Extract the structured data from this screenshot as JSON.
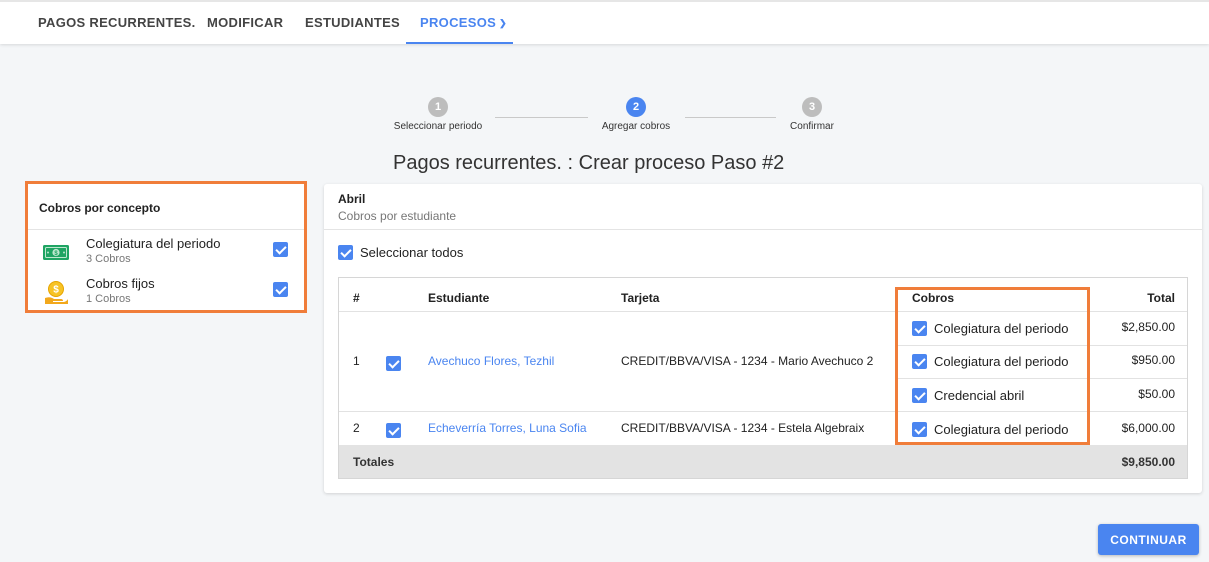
{
  "nav": {
    "tabs": [
      {
        "label": "PAGOS RECURRENTES."
      },
      {
        "label": "MODIFICAR"
      },
      {
        "label": "ESTUDIANTES"
      },
      {
        "label": "PROCESOS"
      }
    ]
  },
  "stepper": {
    "steps": [
      {
        "number": "1",
        "label": "Seleccionar periodo"
      },
      {
        "number": "2",
        "label": "Agregar cobros"
      },
      {
        "number": "3",
        "label": "Confirmar"
      }
    ],
    "active_step": 2
  },
  "page_title": "Pagos recurrentes. : Crear proceso Paso #2",
  "concepts": {
    "title": "Cobros por concepto",
    "items": [
      {
        "name": "Colegiatura del periodo",
        "count": "3 Cobros",
        "icon": "banknote-icon",
        "checked": true
      },
      {
        "name": "Cobros fijos",
        "count": "1 Cobros",
        "icon": "coin-hand-icon",
        "checked": true
      }
    ]
  },
  "panel": {
    "month": "Abril",
    "subtitle": "Cobros por estudiante",
    "select_all_label": "Seleccionar todos",
    "select_all_checked": true
  },
  "table": {
    "headers": {
      "num": "#",
      "student": "Estudiante",
      "card": "Tarjeta",
      "charges": "Cobros",
      "total": "Total"
    },
    "rows": [
      {
        "num": "1",
        "student": "Avechuco Flores, Tezhil",
        "card": "CREDIT/BBVA/VISA - 1234 - Mario Avechuco 2",
        "checked": true,
        "charges": [
          {
            "label": "Colegiatura del periodo",
            "amount": "$2,850.00",
            "checked": true
          },
          {
            "label": "Colegiatura del periodo",
            "amount": "$950.00",
            "checked": true
          },
          {
            "label": "Credencial abril",
            "amount": "$50.00",
            "checked": true
          }
        ]
      },
      {
        "num": "2",
        "student": "Echeverría Torres, Luna Sofia",
        "card": "CREDIT/BBVA/VISA - 1234 - Estela Algebraix",
        "checked": true,
        "charges": [
          {
            "label": "Colegiatura del periodo",
            "amount": "$6,000.00",
            "checked": true
          }
        ]
      }
    ],
    "totals_label": "Totales",
    "totals_value": "$9,850.00"
  },
  "continue_label": "CONTINUAR",
  "colors": {
    "accent": "#4a85f0",
    "highlight": "#f07d3a"
  }
}
